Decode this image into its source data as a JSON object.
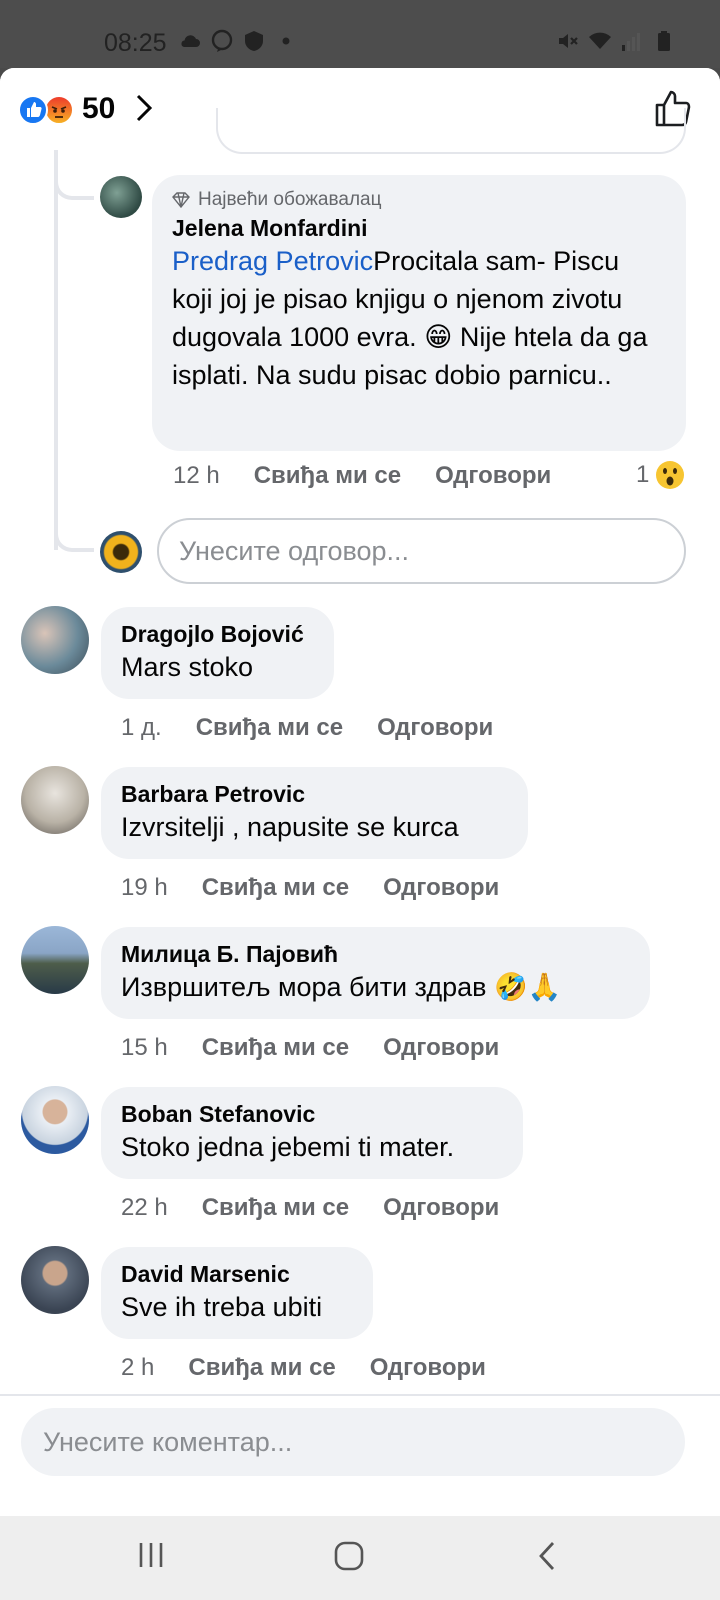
{
  "status": {
    "time": "08:25"
  },
  "header": {
    "reaction_total": "50"
  },
  "reply_comment": {
    "badge": "Највећи обожавалац",
    "author": "Jelena Monfardini",
    "mention": "Predrag Petrovic",
    "text_line1": "Procitala sam-",
    "text_rest": "Piscu koji joj je pisao knjigu o njenom zivotu dugovala 1000 evra. 😁 Nije htela da ga isplati. Na sudu pisac dobio parnicu..",
    "time": "12 h",
    "like": "Свиђа ми се",
    "reply": "Одговори",
    "reaction_count": "1"
  },
  "reply_input": {
    "placeholder": "Унесите одговор..."
  },
  "comments": [
    {
      "author": "Dragojlo Bojović",
      "text": "Mars stoko",
      "time": "1 д.",
      "like": "Свиђа ми се",
      "reply": "Одговори"
    },
    {
      "author": "Barbara Petrovic",
      "text": "Izvrsitelji , napusite se kurca",
      "time": "19 h",
      "like": "Свиђа ми се",
      "reply": "Одговори"
    },
    {
      "author": "Милица Б. Пајовић",
      "text": "Извршитељ мора бити здрав 🤣🙏",
      "time": "15 h",
      "like": "Свиђа ми се",
      "reply": "Одговори"
    },
    {
      "author": "Boban Stefanovic",
      "text": "Stoko jedna jebemi ti mater.",
      "time": "22 h",
      "like": "Свиђа ми се",
      "reply": "Одговори"
    },
    {
      "author": "David Marsenic",
      "text": "Sve ih treba ubiti",
      "time": "2 h",
      "like": "Свиђа ми се",
      "reply": "Одговори"
    }
  ],
  "composer": {
    "placeholder": "Унесите коментар..."
  },
  "colors": {
    "accent": "#1877f2",
    "mention": "#1a5fc8",
    "bubble": "#f0f2f5",
    "meta": "#65676b"
  }
}
